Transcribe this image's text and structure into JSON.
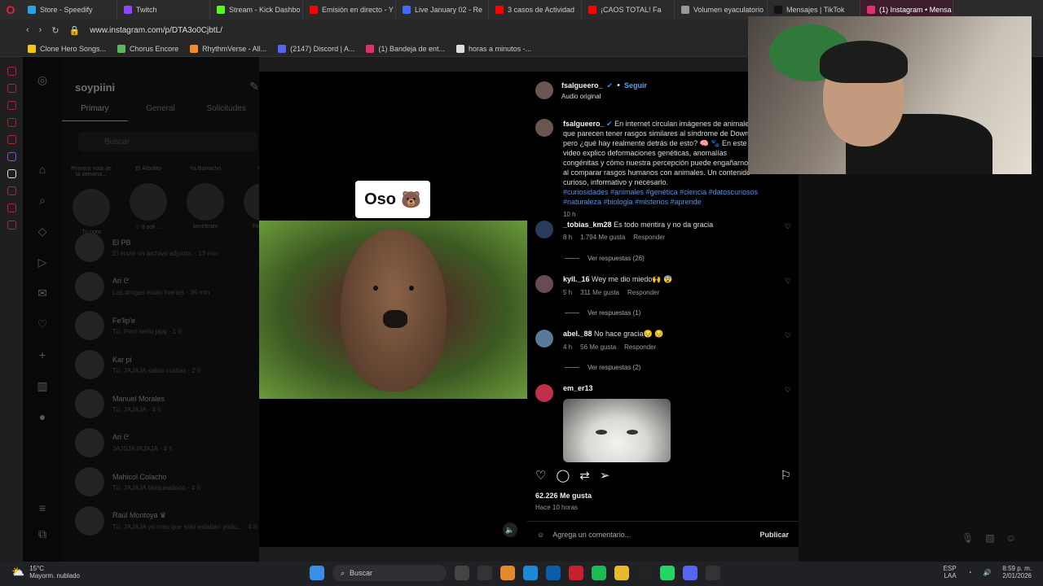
{
  "browser": {
    "tabs": [
      {
        "label": "Store - Speedify",
        "color": "#2aa3e6"
      },
      {
        "label": "Twitch",
        "color": "#9146ff"
      },
      {
        "label": "Stream - Kick Dashbo",
        "color": "#53fc18"
      },
      {
        "label": "Emisión en directo - Y",
        "color": "#ff0000"
      },
      {
        "label": "Live January 02 - Re",
        "color": "#3d6bff"
      },
      {
        "label": "3 casos de Actividad",
        "color": "#ff0000"
      },
      {
        "label": "¡CAOS TOTAL! Fa",
        "color": "#ff0000"
      },
      {
        "label": "Volumen eyaculatorio",
        "color": "#999999"
      },
      {
        "label": "Mensajes | TikTok",
        "color": "#111111"
      },
      {
        "label": "(1) Instagram • Mensa",
        "color": "#e1306c"
      }
    ],
    "url": "www.instagram.com/p/DTA3o0CjbtL/",
    "bookmarks": [
      {
        "label": "Clone Hero Songs...",
        "color": "#f5c518"
      },
      {
        "label": "Chorus Encore",
        "color": "#5cb85c"
      },
      {
        "label": "RhythmVerse - All...",
        "color": "#f28c28"
      },
      {
        "label": "(2147) Discord | A...",
        "color": "#5865f2"
      },
      {
        "label": "(1) Bandeja de ent...",
        "color": "#e1306c"
      },
      {
        "label": "horas a minutos -...",
        "color": "#dddddd"
      }
    ]
  },
  "dm": {
    "title": "soypiini",
    "tabs": [
      "Primary",
      "General",
      "Solicitudes"
    ],
    "search_placeholder": "Buscar",
    "notes": [
      {
        "label": "Primera nota de la semana...",
        "name": "Tu nota"
      },
      {
        "label": "El Arbolito",
        "name": "☆ 8 sofi ..."
      },
      {
        "label": "Ya Borracho",
        "name": "iamirbram"
      },
      {
        "label": "M...",
        "name": "Ferna..."
      }
    ],
    "conversations": [
      {
        "name": "El PB",
        "preview": "El envió un archivo adjunto. · 13 min"
      },
      {
        "name": "Ari ᘓ",
        "preview": "Las drogas están fuertes · 36 min"
      },
      {
        "name": "Fe'lip'e",
        "preview": "Tú: Pero serio jajaj · 1 h"
      },
      {
        "name": "Kar pi",
        "preview": "Tú: JAJAJA sabía cositas · 2 h"
      },
      {
        "name": "Manuel Morales",
        "preview": "Tú: JAJAJA · 4 h"
      },
      {
        "name": "Ari ᘓ",
        "preview": "JAJSJAJAJAJA · 4 h"
      },
      {
        "name": "Mahicol Colacho",
        "preview": "Tú: JAJAJA bloqueadooo · 4 h"
      },
      {
        "name": "Raúl Montoya ♛",
        "preview": "Tú: JAJAJA yo creo que solo estaban yodu... · 4 h"
      }
    ]
  },
  "post": {
    "video_label": "Oso",
    "video_emoji": "🐻",
    "author": "fsalgueero_",
    "follow": "Seguir",
    "audio": "Audio original",
    "caption": "En internet circulan imágenes de animales que parecen tener rasgos similares al síndrome de Down, pero ¿qué hay realmente detrás de esto? 🧠 🐾 En este video explico deformaciones genéticas, anomalías congénitas y cómo nuestra percepción puede engañarnos al comparar rasgos humanos con animales. Un contenido curioso, informativo y necesario.",
    "hashtags": "#curiosidades #animales #genética #ciencia #datoscuriosos #naturaleza #biologia #misterios #aprende",
    "caption_time": "10 h",
    "comments": [
      {
        "user": "_tobias_km28",
        "text": "Es todo mentira y no da gracia",
        "time": "8 h",
        "likes": "1.794 Me gusta",
        "reply": "Responder",
        "replies": "Ver respuestas (26)",
        "avatar": "#2a3a5a"
      },
      {
        "user": "kyll._16",
        "text": "Wey me dio miedo🙌 😨",
        "time": "5 h",
        "likes": "311 Me gusta",
        "reply": "Responder",
        "replies": "Ver respuestas (1)",
        "avatar": "#6a4a55"
      },
      {
        "user": "abel._88",
        "text": "No hace gracia😔 😔",
        "time": "4 h",
        "likes": "56 Me gusta",
        "reply": "Responder",
        "replies": "Ver respuestas (2)",
        "avatar": "#5a7a9a"
      },
      {
        "user": "em_er13",
        "text": "",
        "time": "",
        "likes": "",
        "reply": "",
        "replies": "",
        "avatar": "#c0304a"
      }
    ],
    "like_count": "62.226 Me gusta",
    "posted_ago": "Hace 10 horas",
    "comment_placeholder": "Agrega un comentario...",
    "publish": "Publicar"
  },
  "taskbar": {
    "temperature": "15°C",
    "weather": "Mayorm. nublado",
    "search": "Buscar",
    "lang": "ESP",
    "lang2": "LAA",
    "time": "8:59 p. m.",
    "date": "2/01/2026"
  }
}
